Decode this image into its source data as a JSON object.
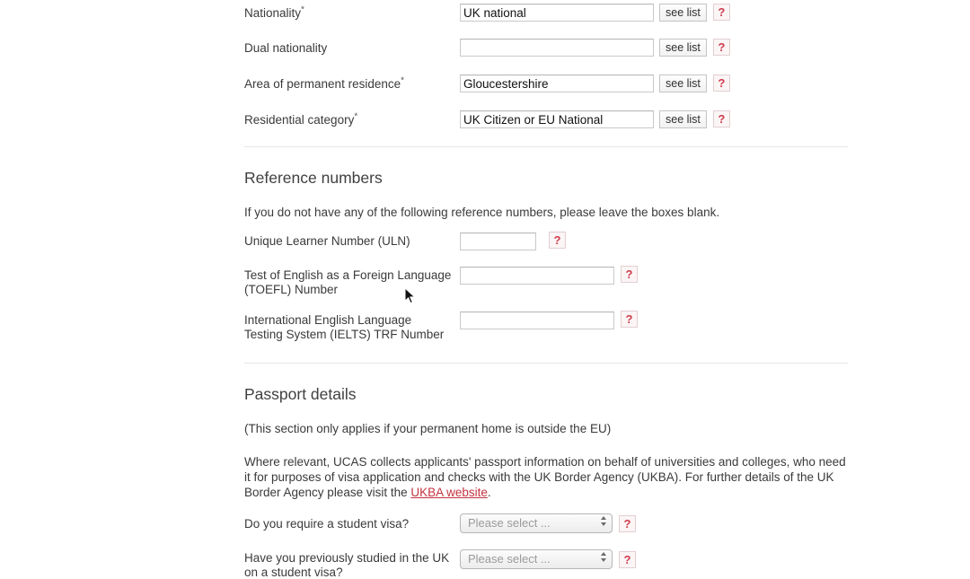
{
  "nationality_section": {
    "rows": [
      {
        "label": "Nationality",
        "required": true,
        "value": "UK national",
        "see_list_label": "see list",
        "help_label": "?",
        "input_width": "wide"
      },
      {
        "label": "Dual nationality",
        "required": false,
        "value": "",
        "see_list_label": "see list",
        "help_label": "?",
        "input_width": "wide"
      },
      {
        "label": "Area of permanent residence",
        "required": true,
        "value": "Gloucestershire",
        "see_list_label": "see list",
        "help_label": "?",
        "input_width": "wide"
      },
      {
        "label": "Residential category",
        "required": true,
        "value": "UK Citizen or EU National",
        "see_list_label": "see list",
        "help_label": "?",
        "input_width": "wide"
      }
    ]
  },
  "reference_numbers": {
    "heading": "Reference numbers",
    "intro": "If you do not have any of the following reference numbers, please leave the boxes blank.",
    "rows": [
      {
        "label": "Unique Learner Number (ULN)",
        "label_line2": "",
        "value": "",
        "help_label": "?",
        "input_width": "small"
      },
      {
        "label": "Test of English as a Foreign Language",
        "label_line2": "(TOEFL) Number",
        "value": "",
        "help_label": "?",
        "input_width": "medium"
      },
      {
        "label": "International English Language",
        "label_line2": "Testing System (IELTS) TRF Number",
        "value": "",
        "help_label": "?",
        "input_width": "medium"
      }
    ]
  },
  "passport_details": {
    "heading": "Passport details",
    "note": "(This section only applies if your permanent home is outside the EU)",
    "body_before_link": "Where relevant, UCAS collects applicants' passport information on behalf of universities and colleges, who need it for purposes of visa application and checks with the UK Border Agency (UKBA). For further details of the UK Border Agency please visit the ",
    "link_text": "UKBA website",
    "body_after_link": ".",
    "rows": [
      {
        "label": "Do you require a student visa?",
        "label_line2": "",
        "select_value": "Please select ...",
        "help_label": "?"
      },
      {
        "label": "Have you previously studied in the UK",
        "label_line2": "on a student visa?",
        "select_value": "Please select ...",
        "help_label": "?"
      }
    ]
  },
  "colors": {
    "help_accent": "#cf3d4e",
    "link": "#c4323f",
    "text": "#3a3a3a",
    "border": "#c9c9c9",
    "divider": "#e6e6e6"
  }
}
